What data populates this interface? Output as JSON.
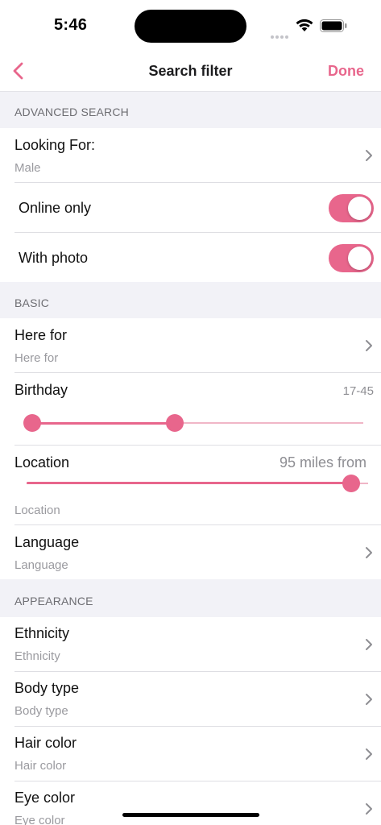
{
  "status": {
    "time": "5:46"
  },
  "nav": {
    "title": "Search filter",
    "done_label": "Done",
    "back_icon": "chevron-left-icon"
  },
  "sections": {
    "advanced": "ADVANCED SEARCH",
    "basic": "BASIC",
    "appearance": "APPEARANCE"
  },
  "advanced": {
    "looking_for": {
      "label": "Looking For:",
      "value": "Male"
    },
    "online_only": {
      "label": "Online only",
      "on": true
    },
    "with_photo": {
      "label": "With photo",
      "on": true
    }
  },
  "basic": {
    "here_for": {
      "label": "Here for",
      "placeholder": "Here for"
    },
    "birthday": {
      "label": "Birthday",
      "range_text": "17-45",
      "min_fraction": 0.0,
      "max_fraction": 0.43
    },
    "location": {
      "label": "Location",
      "distance_text": "95 miles from",
      "fraction": 0.95,
      "placeholder": "Location"
    },
    "language": {
      "label": "Language",
      "placeholder": "Language"
    }
  },
  "appearance": {
    "ethnicity": {
      "label": "Ethnicity",
      "placeholder": "Ethnicity"
    },
    "body_type": {
      "label": "Body type",
      "placeholder": "Body type"
    },
    "hair_color": {
      "label": "Hair color",
      "placeholder": "Hair color"
    },
    "eye_color": {
      "label": "Eye color",
      "placeholder": "Eye color"
    }
  },
  "colors": {
    "accent": "#e8668c",
    "accent_light": "#f0b6c7",
    "group_bg": "#f2f2f7"
  }
}
